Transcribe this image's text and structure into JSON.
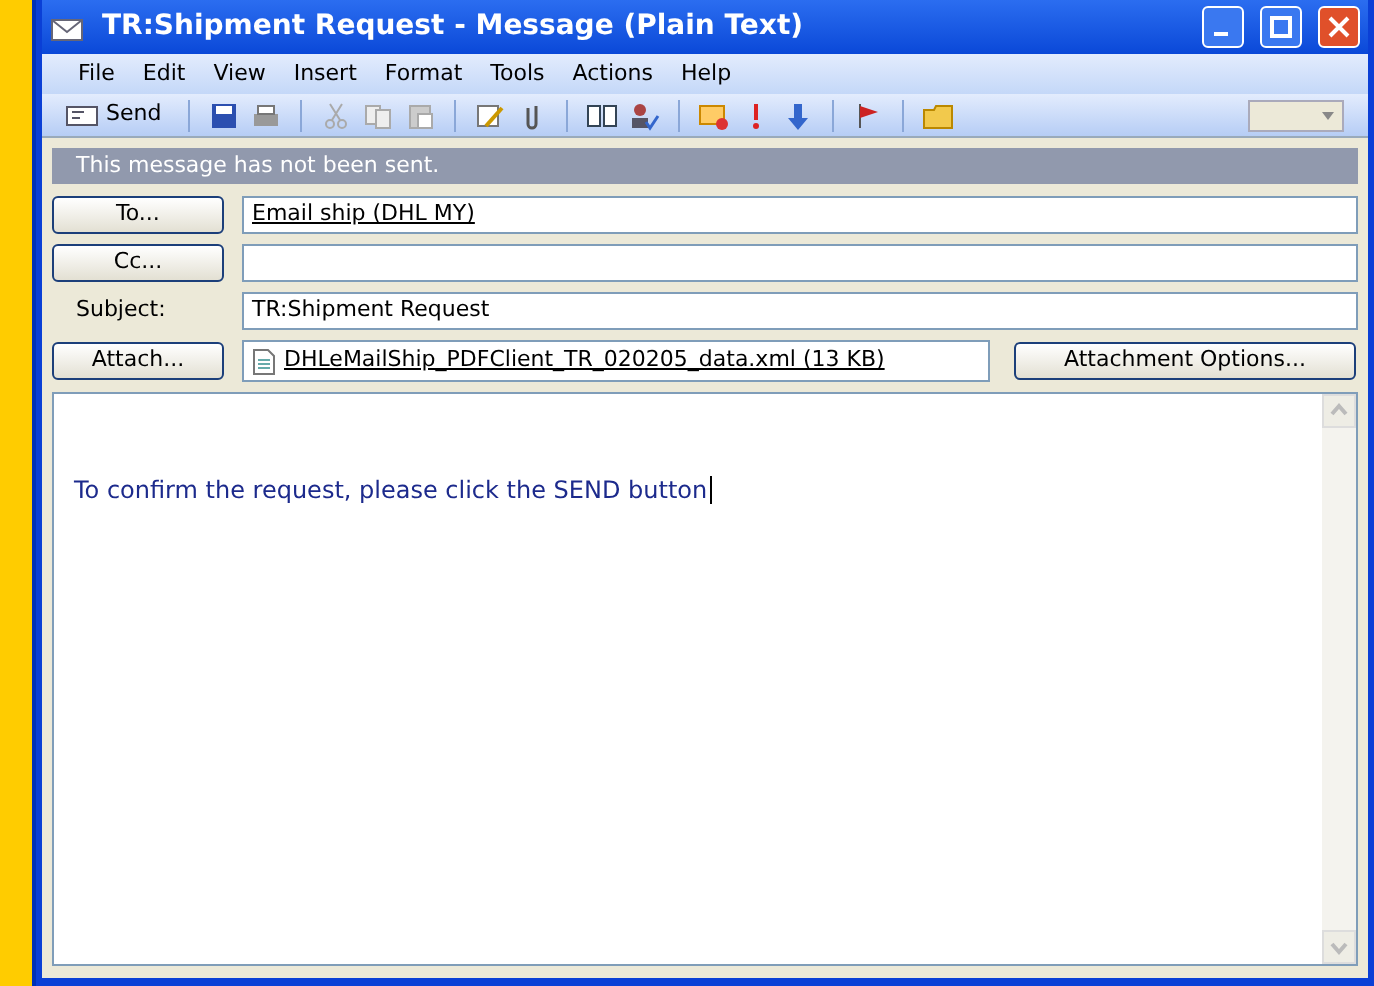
{
  "window": {
    "title": "TR:Shipment Request - Message (Plain Text)"
  },
  "menu": [
    "File",
    "Edit",
    "View",
    "Insert",
    "Format",
    "Tools",
    "Actions",
    "Help"
  ],
  "toolbar": {
    "send_label": "Send"
  },
  "info_bar": "This message has not been sent.",
  "header": {
    "to_button": "To...",
    "to_value": "Email ship (DHL MY)",
    "cc_button": "Cc...",
    "subject_label": "Subject:",
    "subject_value": "TR:Shipment Request",
    "attach_button": "Attach...",
    "attachment": "DHLeMailShip_PDFClient_TR_020205_data.xml (13 KB)",
    "options_button": "Attachment Options..."
  },
  "body": "To confirm the request, please click the SEND button"
}
